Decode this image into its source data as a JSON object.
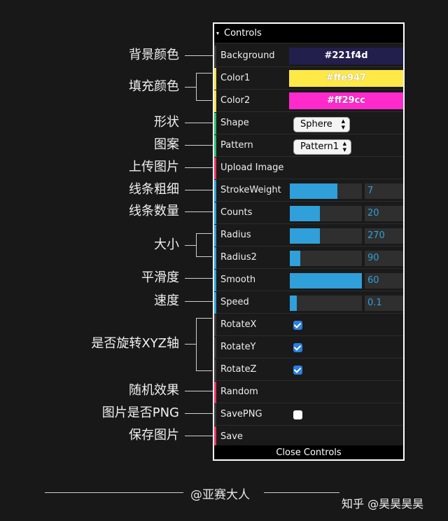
{
  "annotations": [
    "背景颜色",
    "填充颜色",
    "形状",
    "图案",
    "上传图片",
    "线条粗细",
    "线条数量",
    "大小",
    "平滑度",
    "速度",
    "是否旋转XYZ轴",
    "随机效果",
    "图片是否PNG",
    "保存图片"
  ],
  "panel": {
    "title": "Controls",
    "collapse_glyph": "▾",
    "close_label": "Close Controls",
    "rows": {
      "background": {
        "label": "Background",
        "value": "#221f4d",
        "swatch_color": "#221f4d",
        "marker": "#3b3b3b"
      },
      "color1": {
        "label": "Color1",
        "value": "#ffe947",
        "swatch_color": "#ffe947",
        "marker": "#f3e049"
      },
      "color2": {
        "label": "Color2",
        "value": "#ff29cc",
        "swatch_color": "#ff29cc",
        "marker": "#f3e049"
      },
      "shape": {
        "label": "Shape",
        "value": "Sphere",
        "marker": "#2fbd6b"
      },
      "pattern": {
        "label": "Pattern",
        "value": "Pattern1",
        "marker": "#2fbd6b"
      },
      "upload": {
        "label": "Upload Image",
        "marker": "#e8365a"
      },
      "strokeweight": {
        "label": "StrokeWeight",
        "value": "7",
        "fill": 0.66,
        "marker": "#2fa0da"
      },
      "counts": {
        "label": "Counts",
        "value": "20",
        "fill": 0.42,
        "marker": "#2fa0da"
      },
      "radius": {
        "label": "Radius",
        "value": "270",
        "fill": 0.42,
        "marker": "#2fa0da"
      },
      "radius2": {
        "label": "Radius2",
        "value": "90",
        "fill": 0.15,
        "marker": "#2fa0da"
      },
      "smooth": {
        "label": "Smooth",
        "value": "60",
        "fill": 1.0,
        "marker": "#2fa0da"
      },
      "speed": {
        "label": "Speed",
        "value": "0.1",
        "fill": 0.1,
        "marker": "#2fa0da"
      },
      "rotatex": {
        "label": "RotateX",
        "checked": true,
        "marker": "#3b3b3b"
      },
      "rotatey": {
        "label": "RotateY",
        "checked": true,
        "marker": "#3b3b3b"
      },
      "rotatez": {
        "label": "RotateZ",
        "checked": true,
        "marker": "#3b3b3b"
      },
      "random": {
        "label": "Random",
        "marker": "#e8365a"
      },
      "savepng": {
        "label": "SavePNG",
        "checked": false,
        "marker": "#3b3b3b"
      },
      "save": {
        "label": "Save",
        "marker": "#e8365a"
      }
    }
  },
  "footer": {
    "author": "@亚赛大人",
    "watermark": "知乎 @昊昊昊昊"
  },
  "colors": {
    "background": "#181818",
    "accent": "#2fa0da",
    "checkbox": "#2a7fe0"
  }
}
